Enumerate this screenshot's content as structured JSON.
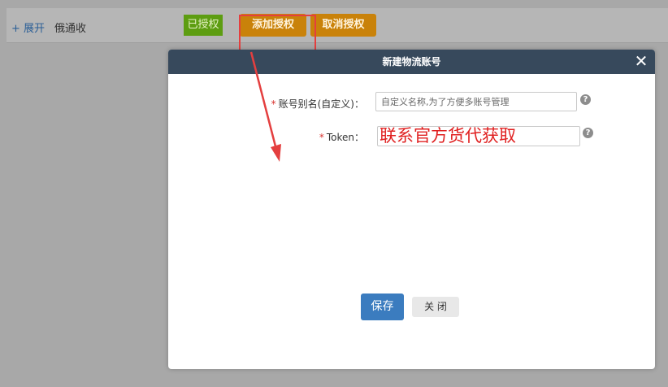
{
  "toolbar": {
    "expand_label": "+ 展开",
    "carrier_name": "俄通收",
    "authorized_label": "已授权",
    "add_auth_label": "添加授权",
    "cancel_auth_label": "取消授权"
  },
  "dialog": {
    "title": "新建物流账号",
    "close_icon": "close-icon",
    "fields": {
      "alias": {
        "required_mark": "*",
        "label": "账号别名(自定义)：",
        "placeholder": "自定义名称,为了方便多账号管理",
        "help_icon": "help-icon"
      },
      "token": {
        "required_mark": "*",
        "label": "Token：",
        "value": "联系官方货代获取",
        "help_icon": "help-icon"
      }
    },
    "save_label": "保存",
    "close_label": "关 闭"
  },
  "colors": {
    "page_bg": "#a8a8a8",
    "toolbar_bg": "#b6b6b6",
    "authorized_bg": "#5d9d11",
    "action_orange": "#c9820a",
    "dialog_header": "#37495c",
    "primary_blue": "#3b7cbf",
    "annotation_red": "#e43f3f"
  },
  "annotation": {
    "box_target": "添加授权",
    "arrow_color": "#e43f3f"
  }
}
